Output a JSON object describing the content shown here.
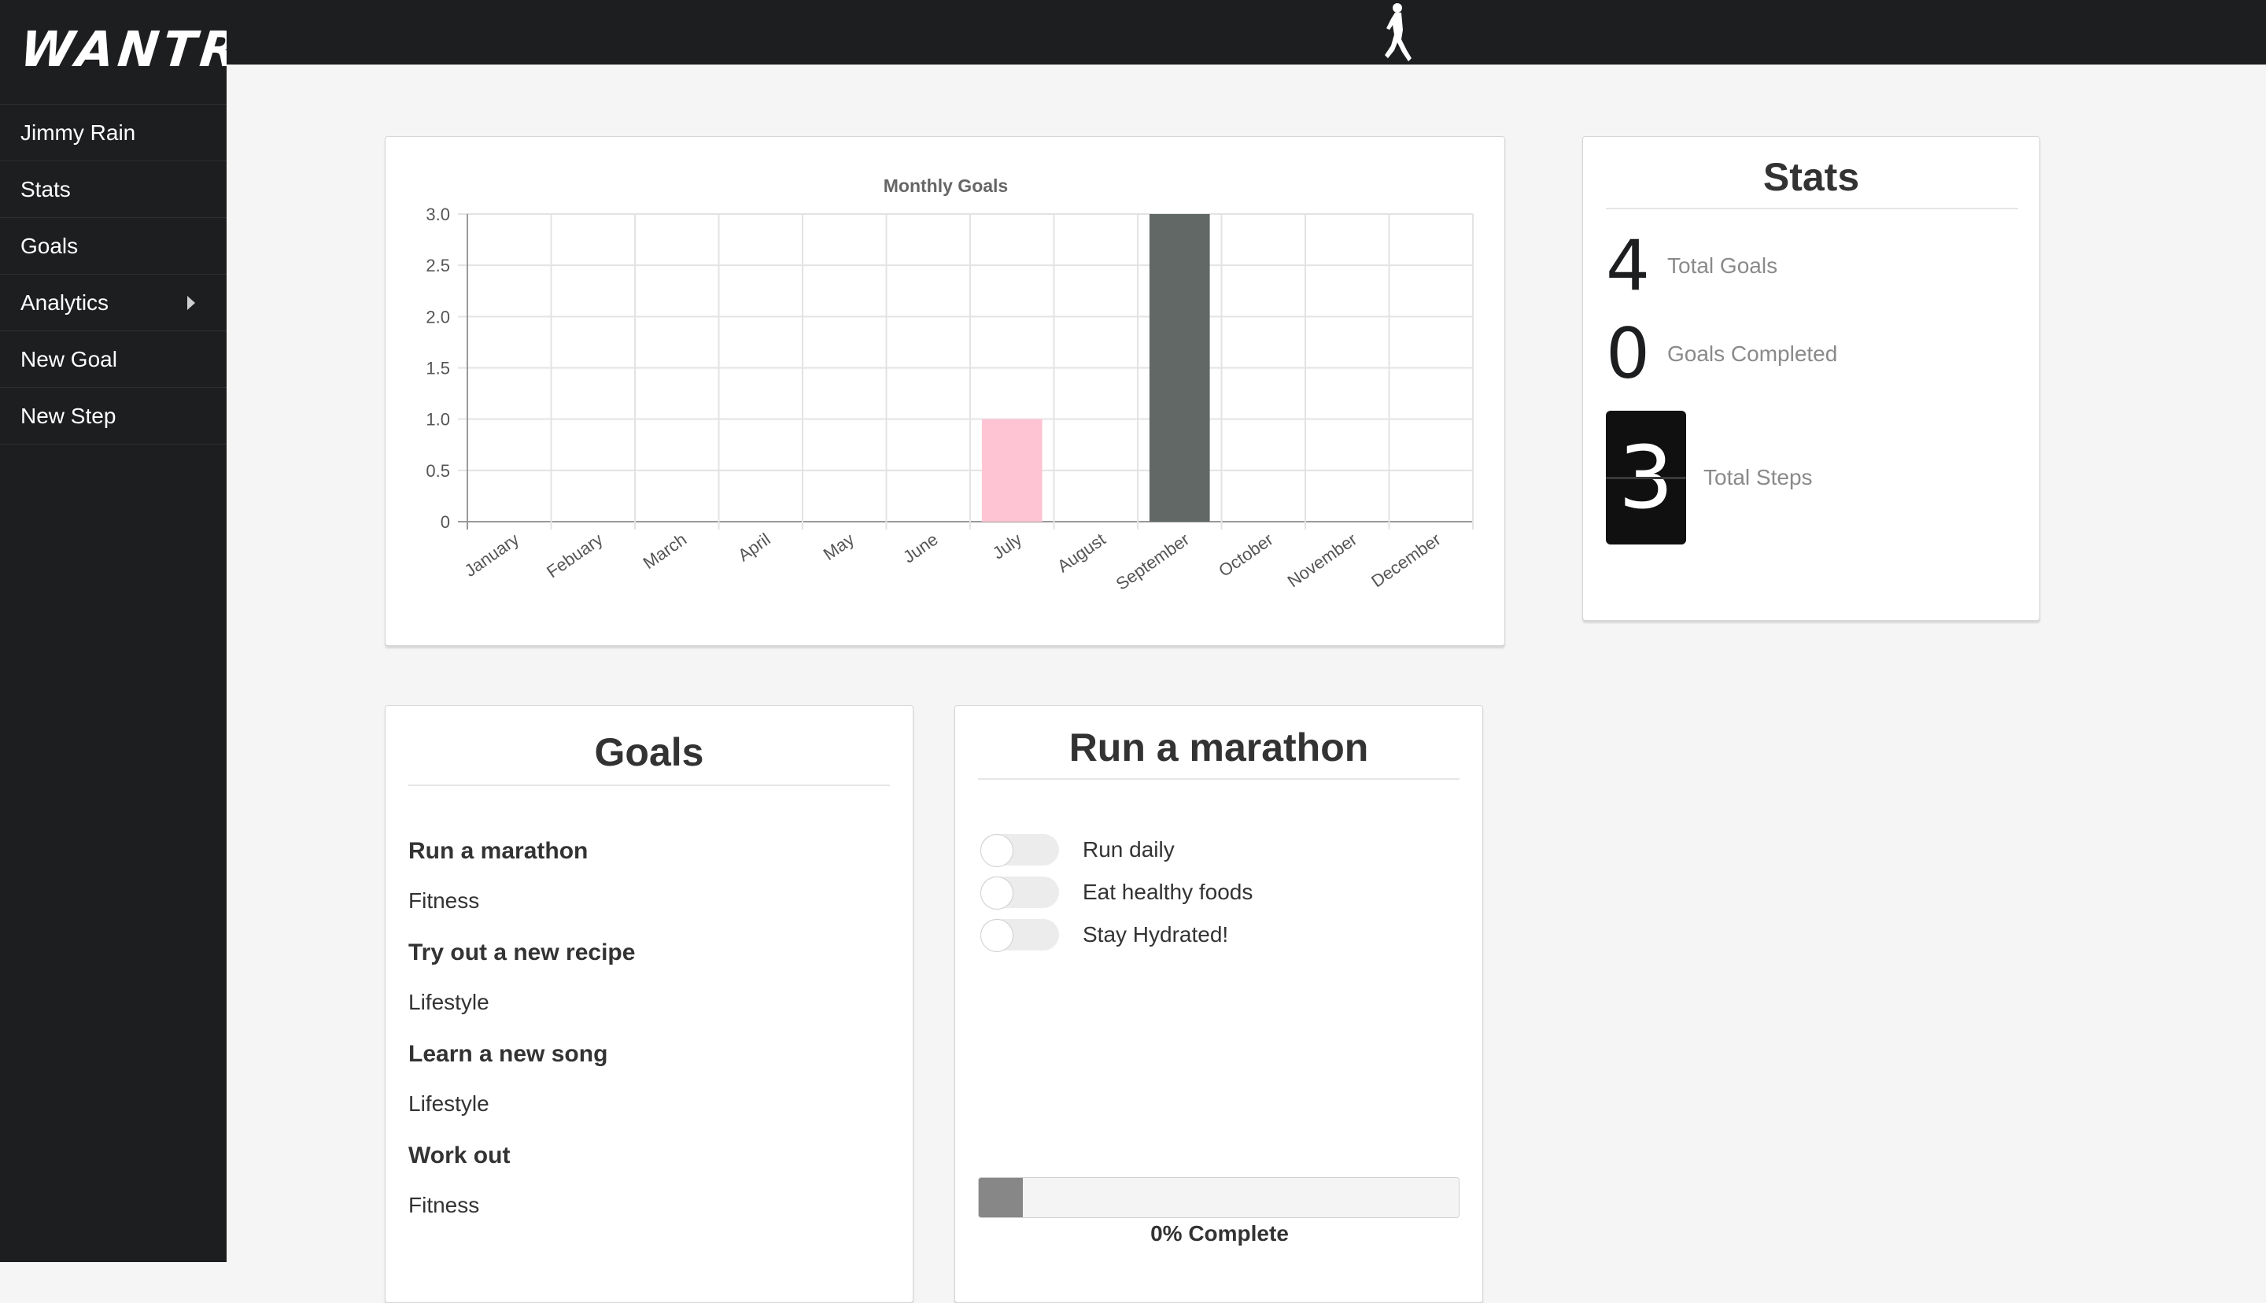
{
  "app": {
    "logo": "WANTR"
  },
  "sidebar": {
    "items": [
      {
        "label": "Jimmy Rain"
      },
      {
        "label": "Stats"
      },
      {
        "label": "Goals"
      },
      {
        "label": "Analytics"
      },
      {
        "label": "New Goal"
      },
      {
        "label": "New Step"
      }
    ]
  },
  "topbar": {
    "icon": "runner-icon"
  },
  "chart_data": {
    "type": "bar",
    "title": "Monthly Goals",
    "categories": [
      "January",
      "Febuary",
      "March",
      "April",
      "May",
      "June",
      "July",
      "August",
      "September",
      "October",
      "November",
      "December"
    ],
    "values": [
      0,
      0,
      0,
      0,
      0,
      0,
      1,
      0,
      3,
      0,
      0,
      0
    ],
    "bar_colors": {
      "July": "#ffc4d4",
      "September": "#626866"
    },
    "yticks": [
      "0",
      "0.5",
      "1.0",
      "1.5",
      "2.0",
      "2.5",
      "3.0"
    ],
    "ylim": [
      0,
      3
    ],
    "grid": true,
    "xlabel": "",
    "ylabel": ""
  },
  "stats": {
    "title": "Stats",
    "total_goals": {
      "value": "4",
      "label": "Total Goals"
    },
    "goals_completed": {
      "value": "0",
      "label": "Goals Completed"
    },
    "total_steps": {
      "value": "3",
      "label": "Total Steps"
    }
  },
  "goals": {
    "title": "Goals",
    "items": [
      {
        "name": "Run a marathon",
        "category": "Fitness"
      },
      {
        "name": "Try out a new recipe",
        "category": "Lifestyle"
      },
      {
        "name": "Learn a new song",
        "category": "Lifestyle"
      },
      {
        "name": "Work out",
        "category": "Fitness"
      }
    ]
  },
  "goal_detail": {
    "title": "Run a marathon",
    "steps": [
      {
        "label": "Run daily",
        "done": false
      },
      {
        "label": "Eat healthy foods",
        "done": false
      },
      {
        "label": "Stay Hydrated!",
        "done": false
      }
    ],
    "progress_percent": 0,
    "progress_text": "0% Complete"
  }
}
